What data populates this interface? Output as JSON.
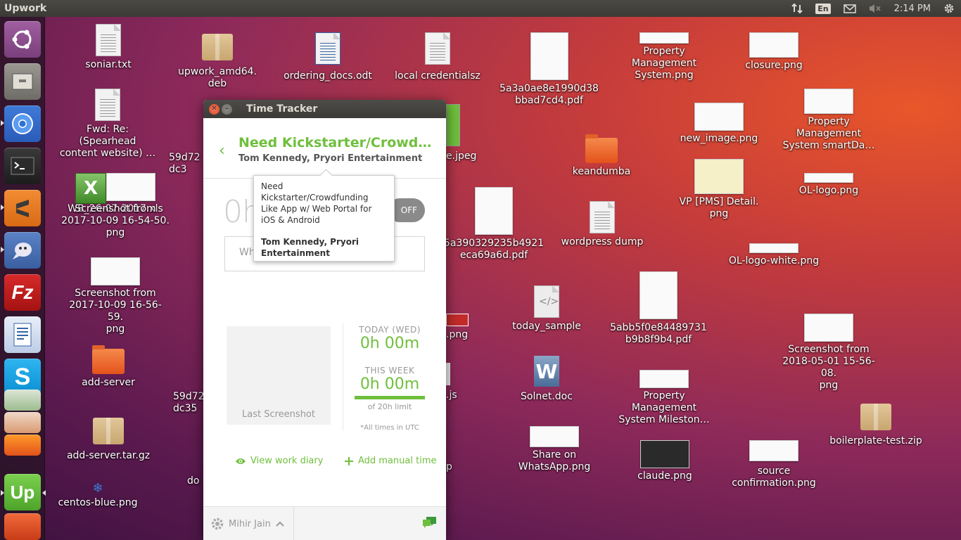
{
  "panel": {
    "app_title": "Upwork",
    "lang": "En",
    "time": "2:14 PM"
  },
  "launcher": {
    "items": [
      "ubuntu-dash",
      "files",
      "chromium",
      "terminal",
      "sublime-text",
      "pidgin",
      "filezilla",
      "libreoffice-writer",
      "skype",
      "libreoffice-calc",
      "libreoffice-impress",
      "firefox",
      "upwork",
      "text-editor"
    ]
  },
  "desktop": {
    "icons": [
      {
        "label": "soniar.txt"
      },
      {
        "label": "upwork_amd64.\ndeb"
      },
      {
        "label": "ordering_docs.odt"
      },
      {
        "label": "local credentialsz"
      },
      {
        "label": "5a3a0ae8e1990d38\nbbad7cd4.pdf"
      },
      {
        "label": "Property\nManagement\nSystem.png"
      },
      {
        "label": "closure.png"
      },
      {
        "label": "Fwd: Re:\n(Spearhead\ncontent website) …"
      },
      {
        "label": "new_image.png"
      },
      {
        "label": "Property\nManagement\nSystem  smartDa…"
      },
      {
        "label": "keandumba"
      },
      {
        "label": "VP [PMS] Detail.\npng"
      },
      {
        "label": "OL-logo.png"
      },
      {
        "label": "WB_26-07-2017.xls"
      },
      {
        "label": "Screenshot from\n2017-10-09 16-54-50.\npng"
      },
      {
        "label": "59d72\ndc3"
      },
      {
        "label": "e.jpeg"
      },
      {
        "label": "5a390329235b4921\neca69a6d.pdf"
      },
      {
        "label": "wordpress dump"
      },
      {
        "label": "OL-logo-white.png"
      },
      {
        "label": "Screenshot from\n2017-10-09 16-56-59.\npng"
      },
      {
        "label": "today_sample"
      },
      {
        "label": "5abb5f0e84489731\nb9b8f9b4.pdf"
      },
      {
        "label": "Screenshot from\n2018-05-01 15-56-08.\npng"
      },
      {
        "label": "add-server"
      },
      {
        "label": ".png"
      },
      {
        "label": "Solnet.doc"
      },
      {
        "label": "59d72\ndc35"
      },
      {
        "label": ".js"
      },
      {
        "label": "Property\nManagement\nSystem  Mileston…"
      },
      {
        "label": "boilerplate-test.zip"
      },
      {
        "label": "add-server.tar.gz"
      },
      {
        "label": "Share on\nWhatsApp.png"
      },
      {
        "label": "claude.png"
      },
      {
        "label": "source\nconfirmation.png"
      },
      {
        "label": "do"
      },
      {
        "label": "centos-blue.png"
      },
      {
        "label": "p"
      }
    ]
  },
  "tracker": {
    "window_title": "Time Tracker",
    "back_icon": "chevron-left-icon",
    "job_title": "Need Kickstarter/Crowdfun...",
    "job_client": "Tom Kennedy, Pryori Entertainment",
    "timer": "0h",
    "toggle_label": "OFF",
    "memo_placeholder": "Wh",
    "tooltip": {
      "title": "Need Kickstarter/Crowdfunding Like App w/ Web Portal for iOS & Android",
      "client": "Tom Kennedy, Pryori Entertainment"
    },
    "last_screenshot": "Last Screenshot",
    "today_label": "TODAY (WED)",
    "today_value": "0h 00m",
    "week_label": "THIS WEEK",
    "week_value": "0h 00m",
    "limit": "of 20h limit",
    "utc_note": "*All times in UTC",
    "view_diary": "View work diary",
    "add_manual": "Add manual time",
    "user": "Mihir Jain",
    "accent": "#6fbf3c"
  }
}
